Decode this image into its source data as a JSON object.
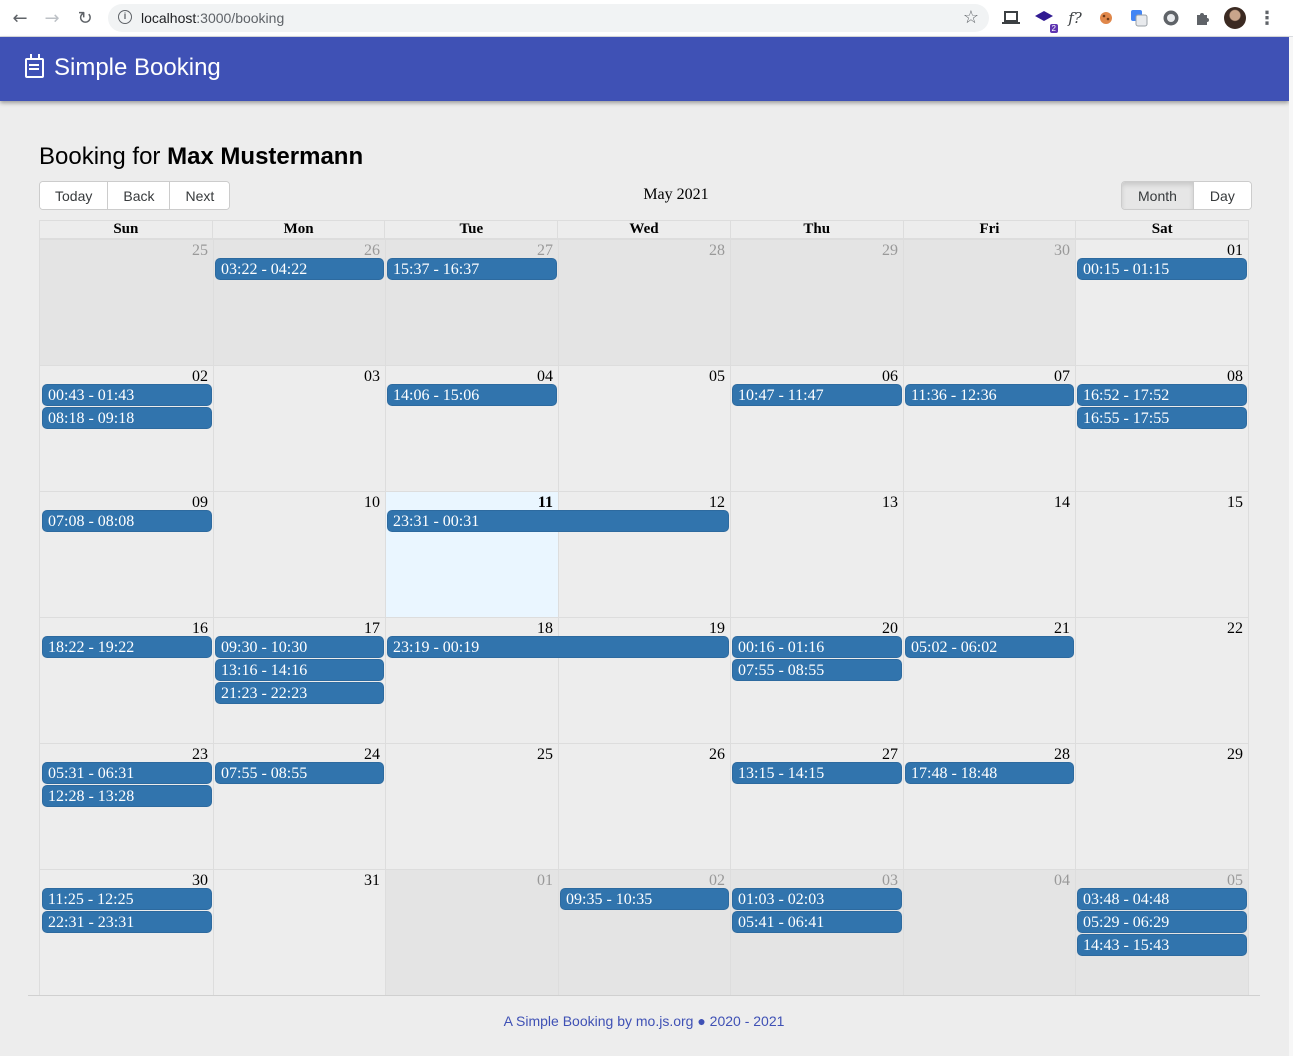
{
  "browser": {
    "url_host": "localhost",
    "url_port_path": ":3000/booking",
    "ext_badge": "2",
    "ext_formula": "f?"
  },
  "app": {
    "title": "Simple Booking",
    "icon": "calendar-icon",
    "brand_color": "#3f51b5",
    "event_color": "#3174ad"
  },
  "heading": {
    "prefix": "Booking for",
    "name": "Max Mustermann"
  },
  "toolbar": {
    "nav": [
      "Today",
      "Back",
      "Next"
    ],
    "label": "May 2021",
    "views": [
      "Month",
      "Day"
    ],
    "active_view": "Month"
  },
  "calendar": {
    "weekdays": [
      "Sun",
      "Mon",
      "Tue",
      "Wed",
      "Thu",
      "Fri",
      "Sat"
    ],
    "weeks": [
      [
        {
          "d": "25",
          "off": true,
          "ev": []
        },
        {
          "d": "26",
          "off": true,
          "ev": [
            "03:22 - 04:22"
          ]
        },
        {
          "d": "27",
          "off": true,
          "ev": [
            "15:37 - 16:37"
          ]
        },
        {
          "d": "28",
          "off": true,
          "ev": []
        },
        {
          "d": "29",
          "off": true,
          "ev": []
        },
        {
          "d": "30",
          "off": true,
          "ev": []
        },
        {
          "d": "01",
          "off": false,
          "ev": [
            "00:15 - 01:15"
          ]
        }
      ],
      [
        {
          "d": "02",
          "ev": [
            "00:43 - 01:43",
            "08:18 - 09:18"
          ]
        },
        {
          "d": "03",
          "ev": []
        },
        {
          "d": "04",
          "ev": [
            "14:06 - 15:06"
          ]
        },
        {
          "d": "05",
          "ev": []
        },
        {
          "d": "06",
          "ev": [
            "10:47 - 11:47"
          ]
        },
        {
          "d": "07",
          "ev": [
            "11:36 - 12:36"
          ]
        },
        {
          "d": "08",
          "ev": [
            "16:52 - 17:52",
            "16:55 - 17:55"
          ]
        }
      ],
      [
        {
          "d": "09",
          "ev": [
            "07:08 - 08:08"
          ]
        },
        {
          "d": "10",
          "ev": []
        },
        {
          "d": "11",
          "today": true,
          "ev": [
            {
              "t": "23:31 - 00:31",
              "span": 2
            }
          ]
        },
        {
          "d": "12",
          "ev": []
        },
        {
          "d": "13",
          "ev": []
        },
        {
          "d": "14",
          "ev": []
        },
        {
          "d": "15",
          "ev": []
        }
      ],
      [
        {
          "d": "16",
          "ev": [
            "18:22 - 19:22"
          ]
        },
        {
          "d": "17",
          "ev": [
            "09:30 - 10:30",
            "13:16 - 14:16",
            "21:23 - 22:23"
          ]
        },
        {
          "d": "18",
          "ev": [
            {
              "t": "23:19 - 00:19",
              "span": 2
            }
          ]
        },
        {
          "d": "19",
          "ev": []
        },
        {
          "d": "20",
          "ev": [
            "00:16 - 01:16",
            "07:55 - 08:55"
          ]
        },
        {
          "d": "21",
          "ev": [
            "05:02 - 06:02"
          ]
        },
        {
          "d": "22",
          "ev": []
        }
      ],
      [
        {
          "d": "23",
          "ev": [
            "05:31 - 06:31",
            "12:28 - 13:28"
          ]
        },
        {
          "d": "24",
          "ev": [
            "07:55 - 08:55"
          ]
        },
        {
          "d": "25",
          "ev": []
        },
        {
          "d": "26",
          "ev": []
        },
        {
          "d": "27",
          "ev": [
            "13:15 - 14:15"
          ]
        },
        {
          "d": "28",
          "ev": [
            "17:48 - 18:48"
          ]
        },
        {
          "d": "29",
          "ev": []
        }
      ],
      [
        {
          "d": "30",
          "ev": [
            "11:25 - 12:25",
            "22:31 - 23:31"
          ]
        },
        {
          "d": "31",
          "ev": []
        },
        {
          "d": "01",
          "off": true,
          "ev": []
        },
        {
          "d": "02",
          "off": true,
          "ev": [
            "09:35 - 10:35"
          ]
        },
        {
          "d": "03",
          "off": true,
          "ev": [
            "01:03 - 02:03",
            "05:41 - 06:41"
          ]
        },
        {
          "d": "04",
          "off": true,
          "ev": []
        },
        {
          "d": "05",
          "off": true,
          "ev": [
            "03:48 - 04:48",
            "05:29 - 06:29",
            "14:43 - 15:43"
          ]
        }
      ]
    ]
  },
  "footer": {
    "text": "A Simple Booking by mo.js.org ● 2020 - 2021"
  }
}
